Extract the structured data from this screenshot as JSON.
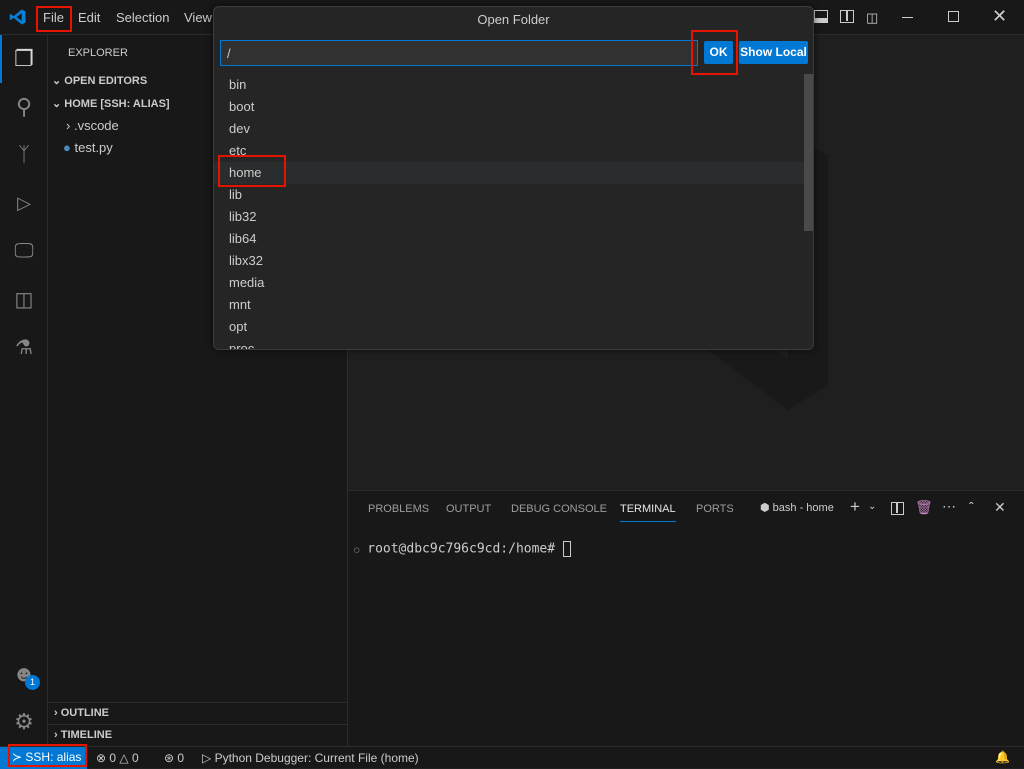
{
  "menu": {
    "items": [
      "File",
      "Edit",
      "Selection",
      "View"
    ]
  },
  "dialog": {
    "title": "Open Folder",
    "input_value": "/",
    "ok_label": "OK",
    "show_local_label": "Show Local",
    "items": [
      "bin",
      "boot",
      "dev",
      "etc",
      "home",
      "lib",
      "lib32",
      "lib64",
      "libx32",
      "media",
      "mnt",
      "opt",
      "proc"
    ],
    "selected": "home"
  },
  "sidebar": {
    "title": "EXPLORER",
    "open_editors": "OPEN EDITORS",
    "folder": "HOME [SSH: ALIAS]",
    "files": [
      ".vscode",
      "test.py"
    ],
    "outline": "OUTLINE",
    "timeline": "TIMELINE"
  },
  "panel": {
    "tabs": [
      "PROBLEMS",
      "OUTPUT",
      "DEBUG CONSOLE",
      "TERMINAL",
      "PORTS"
    ],
    "active_tab": "TERMINAL",
    "terminal_name": "bash - home",
    "prompt": "root@dbc9c796c9cd:/home#"
  },
  "status": {
    "remote": "SSH: alias",
    "errors": "0",
    "warnings": "0",
    "ports": "0",
    "debug": "Python Debugger: Current File (home)"
  },
  "accounts_badge": "1",
  "colors": {
    "accent": "#0078d4",
    "highlight": "#e51400"
  }
}
